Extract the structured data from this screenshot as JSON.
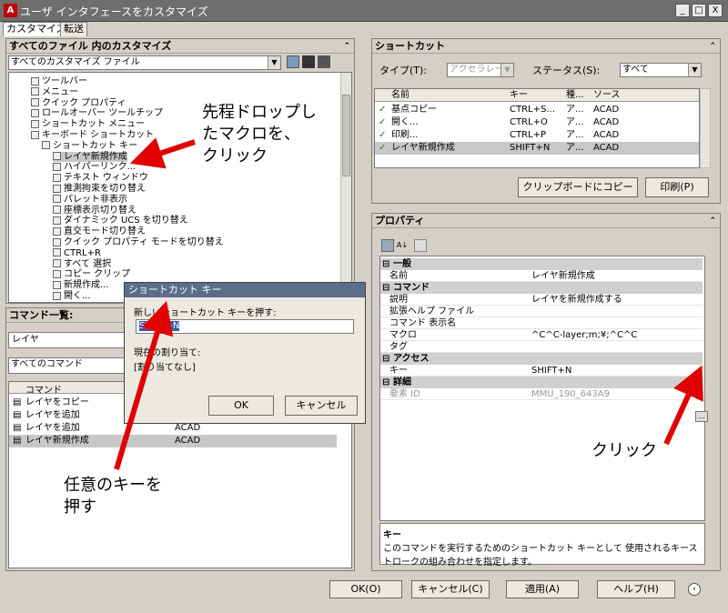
{
  "window": {
    "title": "ユーザ インタフェースをカスタマイズ",
    "min": "_",
    "max": "□",
    "close": "X"
  },
  "tabs": [
    "カスタマイズ",
    "転送"
  ],
  "left": {
    "header": "すべてのファイル 内のカスタマイズ",
    "file_combo": "すべてのカスタマイズ ファイル",
    "tree": [
      {
        "label": "ツールバー",
        "indent": 1
      },
      {
        "label": "メニュー",
        "indent": 1
      },
      {
        "label": "クイック プロパティ",
        "indent": 1
      },
      {
        "label": "ロールオーバー ツールチップ",
        "indent": 1
      },
      {
        "label": "ショートカット メニュー",
        "indent": 1
      },
      {
        "label": "キーボード ショートカット",
        "indent": 1
      },
      {
        "label": "ショートカット キー",
        "indent": 2
      },
      {
        "label": "レイヤ新規作成",
        "indent": 3,
        "selected": true
      },
      {
        "label": "ハイパーリンク...",
        "indent": 3
      },
      {
        "label": "テキスト ウィンドウ",
        "indent": 3
      },
      {
        "label": "推測拘束を切り替え",
        "indent": 3
      },
      {
        "label": "パレット非表示",
        "indent": 3
      },
      {
        "label": "座標表示切り替え",
        "indent": 3
      },
      {
        "label": "ダイナミック UCS を切り替え",
        "indent": 3
      },
      {
        "label": "直交モード切り替え",
        "indent": 3
      },
      {
        "label": "クイック プロパティ モードを切り替え",
        "indent": 3
      },
      {
        "label": "CTRL+R",
        "indent": 3
      },
      {
        "label": "すべて 選択",
        "indent": 3
      },
      {
        "label": "コピー クリップ",
        "indent": 3
      },
      {
        "label": "新規作成...",
        "indent": 3
      },
      {
        "label": "開く...",
        "indent": 3
      }
    ],
    "commands_header": "コマンド一覧:",
    "search_value": "レイヤ",
    "command_filter": "すべてのコマンド",
    "command_col": "コマンド",
    "commands": [
      {
        "name": "レイヤをコピー",
        "source": ""
      },
      {
        "name": "レイヤを追加",
        "source": ""
      },
      {
        "name": "レイヤを追加",
        "source": "ACAD"
      },
      {
        "name": "レイヤ新規作成",
        "source": "ACAD"
      }
    ]
  },
  "shortcuts": {
    "header": "ショートカット",
    "type_label": "タイプ(T):",
    "type_value": "アクセラレータ",
    "status_label": "ステータス(S):",
    "status_value": "すべて",
    "columns": [
      "名前",
      "キー",
      "種...",
      "ソース"
    ],
    "rows": [
      {
        "name": "基点コピー",
        "key": "CTRL+S...",
        "type": "ア...",
        "source": "ACAD"
      },
      {
        "name": "開く...",
        "key": "CTRL+O",
        "type": "ア...",
        "source": "ACAD"
      },
      {
        "name": "印刷...",
        "key": "CTRL+P",
        "type": "ア...",
        "source": "ACAD"
      },
      {
        "name": "レイヤ新規作成",
        "key": "SHIFT+N",
        "type": "ア...",
        "source": "ACAD"
      }
    ],
    "copy_button": "クリップボードにコピー",
    "print_button": "印刷(P)"
  },
  "properties": {
    "header": "プロパティ",
    "categories": [
      {
        "name": "一般",
        "rows": [
          {
            "k": "名前",
            "v": "レイヤ新規作成"
          }
        ]
      },
      {
        "name": "コマンド",
        "rows": [
          {
            "k": "説明",
            "v": "レイヤを新規作成する"
          },
          {
            "k": "拡張ヘルプ ファイル",
            "v": ""
          },
          {
            "k": "コマンド 表示名",
            "v": ""
          },
          {
            "k": "マクロ",
            "v": "^C^C-layer;m;¥;^C^C"
          },
          {
            "k": "タグ",
            "v": ""
          }
        ]
      },
      {
        "name": "アクセス",
        "rows": [
          {
            "k": "キー",
            "v": "SHIFT+N"
          }
        ]
      },
      {
        "name": "詳細",
        "rows": [
          {
            "k": "要素 ID",
            "v": "MMU_190_643A9"
          }
        ]
      }
    ],
    "help_title": "キー",
    "help_text": "このコマンドを実行するためのショートカット キーとして 使用されるキーストロークの組み合わせを指定します。",
    "ellipsis": "..."
  },
  "dialog": {
    "title": "ショートカット キー",
    "prompt": "新しいショートカット キーを押す:",
    "key_value": "SHIFT+N",
    "current_label": "現在の割り当て:",
    "current_value": "[割り当てなし]",
    "ok": "OK",
    "cancel": "キャンセル"
  },
  "footer": {
    "ok": "OK(O)",
    "cancel": "キャンセル(C)",
    "apply": "適用(A)",
    "help": "ヘルプ(H)"
  },
  "annotations": {
    "a1": [
      "先程ドロップし",
      "たマクロを、",
      "クリック"
    ],
    "a2": [
      "任意のキーを",
      "押す"
    ],
    "a3": "クリック"
  }
}
